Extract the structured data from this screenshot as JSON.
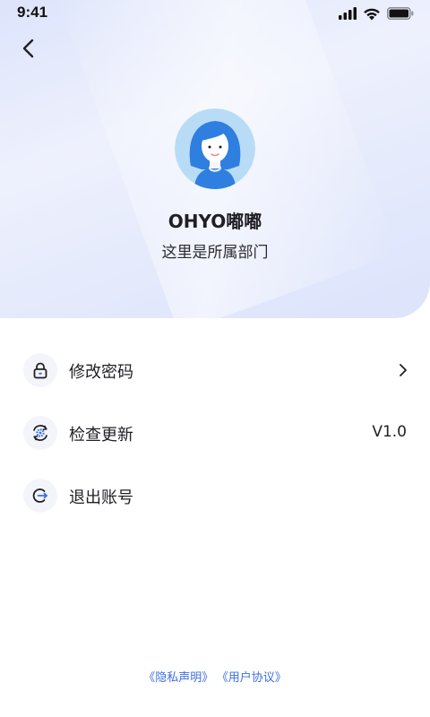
{
  "status_bar": {
    "time": "9:41"
  },
  "profile": {
    "name": "OHYO嘟嘟",
    "department": "这里是所属部门"
  },
  "menu": {
    "change_password": {
      "label": "修改密码"
    },
    "check_update": {
      "label": "检查更新",
      "value": "V1.0"
    },
    "logout": {
      "label": "退出账号"
    }
  },
  "footer": {
    "privacy": "《隐私声明》",
    "agreement": "《用户协议》"
  },
  "colors": {
    "accent": "#3d6fe0",
    "avatar_bg": "#b9dcf6",
    "avatar_hair": "#2f7fe0"
  }
}
